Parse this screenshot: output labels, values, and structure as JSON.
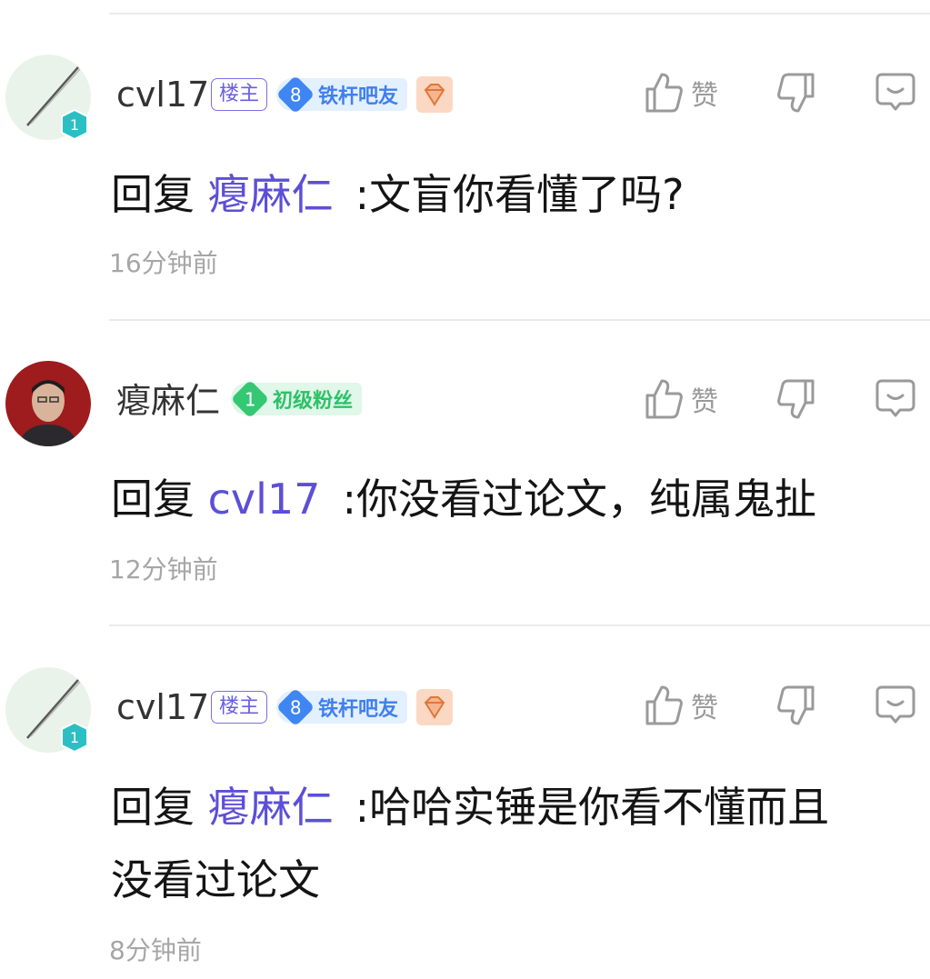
{
  "comments": [
    {
      "username": "cvl17",
      "owner_badge": "楼主",
      "level": "8",
      "level_title": "铁杆吧友",
      "level_color": "blue",
      "like_label": "赞",
      "reply_prefix": "回复",
      "reply_target": "瘪麻仁",
      "reply_text": ":文盲你看懂了吗?",
      "reply_text2": "",
      "time": "16分钟前",
      "avatar_shield_level": "1"
    },
    {
      "username": "瘪麻仁",
      "level": "1",
      "level_title": "初级粉丝",
      "level_color": "green",
      "like_label": "赞",
      "reply_prefix": "回复",
      "reply_target": "cvl17",
      "reply_text": ":你没看过论文，纯属鬼扯",
      "reply_text2": "",
      "time": "12分钟前"
    },
    {
      "username": "cvl17",
      "owner_badge": "楼主",
      "level": "8",
      "level_title": "铁杆吧友",
      "level_color": "blue",
      "like_label": "赞",
      "reply_prefix": "回复",
      "reply_target": "瘪麻仁",
      "reply_text": ":哈哈实锤是你看不懂而且",
      "reply_text2": "没看过论文",
      "time": "8分钟前",
      "avatar_shield_level": "1"
    }
  ],
  "colors": {
    "mention": "#5c4fd6",
    "owner_badge": "#6a5ee0",
    "level_blue": "#3f86f4",
    "level_green": "#35c872",
    "meta_gray": "#a6a6a6"
  }
}
